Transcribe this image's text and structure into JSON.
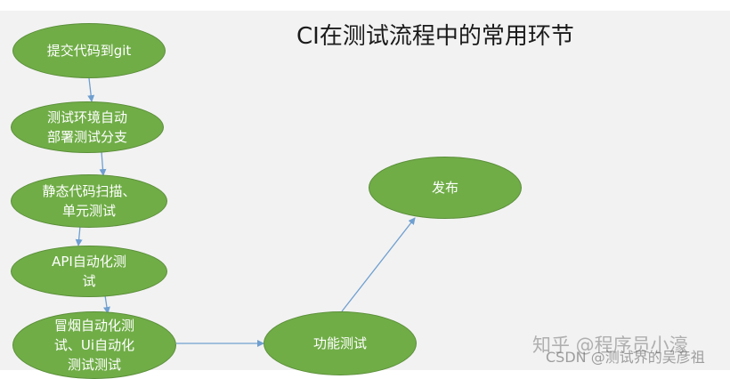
{
  "title": "CI在测试流程中的常用环节",
  "nodes": {
    "commit": "提交代码到git",
    "deploy": "测试环境自动\n部署测试分支",
    "static": "静态代码扫描、\n单元测试",
    "api": "API自动化测\n试",
    "smoke": "冒烟自动化测\n试、Ui自动化\n测试测试",
    "functional": "功能测试",
    "release": "发布"
  },
  "colors": {
    "node_fill": "#70ad47",
    "arrow": "#6f9fd0",
    "background": "#f2f2f2"
  },
  "watermarks": {
    "zhihu": "知乎 @程序员小濠",
    "csdn": "CSDN @测试界的吴彦祖"
  }
}
